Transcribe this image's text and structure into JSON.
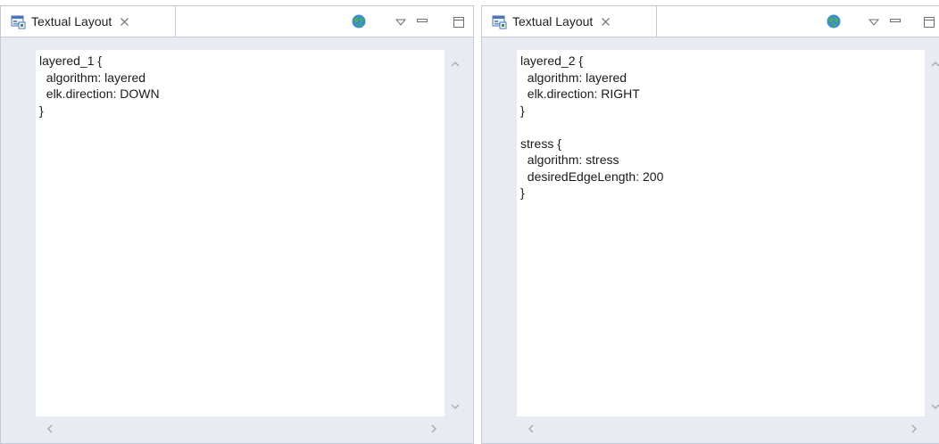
{
  "views": [
    {
      "tab_label": "Textual Layout",
      "icons": {
        "tab": "layout-view-icon",
        "close": "close-icon",
        "sync": "sync-globe-icon",
        "menu": "view-menu-icon",
        "minimize": "minimize-icon",
        "maximize": "maximize-icon"
      },
      "code": "layered_1 {\n  algorithm: layered\n  elk.direction: DOWN\n}"
    },
    {
      "tab_label": "Textual Layout",
      "icons": {
        "tab": "layout-view-icon",
        "close": "close-icon",
        "sync": "sync-globe-icon",
        "menu": "view-menu-icon",
        "minimize": "minimize-icon",
        "maximize": "maximize-icon"
      },
      "code": "layered_2 {\n  algorithm: layered\n  elk.direction: RIGHT\n}\n\nstress {\n  algorithm: stress\n  desiredEdgeLength: 200\n}"
    }
  ],
  "colors": {
    "frame_bg": "#e8ecf2",
    "border": "#c4c9d2",
    "editor_bg": "#ffffff"
  }
}
